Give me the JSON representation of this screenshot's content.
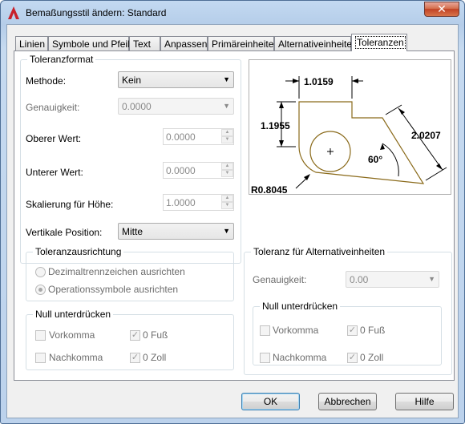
{
  "window": {
    "title": "Bemaßungsstil ändern: Standard",
    "close_label": "✕",
    "accent": "#c8202a"
  },
  "tabs": [
    "Linien",
    "Symbole und Pfeile",
    "Text",
    "Anpassen",
    "Primäreinheiten",
    "Alternativeinheiten",
    "Toleranzen"
  ],
  "tolerance_format": {
    "title": "Toleranzformat",
    "method_label": "Methode:",
    "method_value": "Kein",
    "precision_label": "Genauigkeit:",
    "precision_value": "0.0000",
    "upper_label": "Oberer Wert:",
    "upper_value": "0.0000",
    "lower_label": "Unterer Wert:",
    "lower_value": "0.0000",
    "scale_label": "Skalierung für Höhe:",
    "scale_value": "1.0000",
    "vpos_label": "Vertikale Position:",
    "vpos_value": "Mitte"
  },
  "alignment": {
    "title": "Toleranzausrichtung",
    "option1": "Dezimaltrennzeichen ausrichten",
    "option2": "Operationssymbole ausrichten"
  },
  "zero_suppress": {
    "title": "Null unterdrücken",
    "leading": "Vorkomma",
    "trailing": "Nachkomma",
    "feet": "0 Fuß",
    "inches": "0 Zoll"
  },
  "alt_tolerance": {
    "title": "Toleranz für Alternativeinheiten",
    "precision_label": "Genauigkeit:",
    "precision_value": "0.00",
    "zero_title": "Null unterdrücken",
    "leading": "Vorkomma",
    "trailing": "Nachkomma",
    "feet": "0 Fuß",
    "inches": "0 Zoll"
  },
  "preview": {
    "dim_top": "1.0159",
    "dim_left": "1.1955",
    "dim_right": "2.0207",
    "angle": "60°",
    "radius": "R0.8045"
  },
  "buttons": {
    "ok": "OK",
    "cancel": "Abbrechen",
    "help": "Hilfe"
  }
}
